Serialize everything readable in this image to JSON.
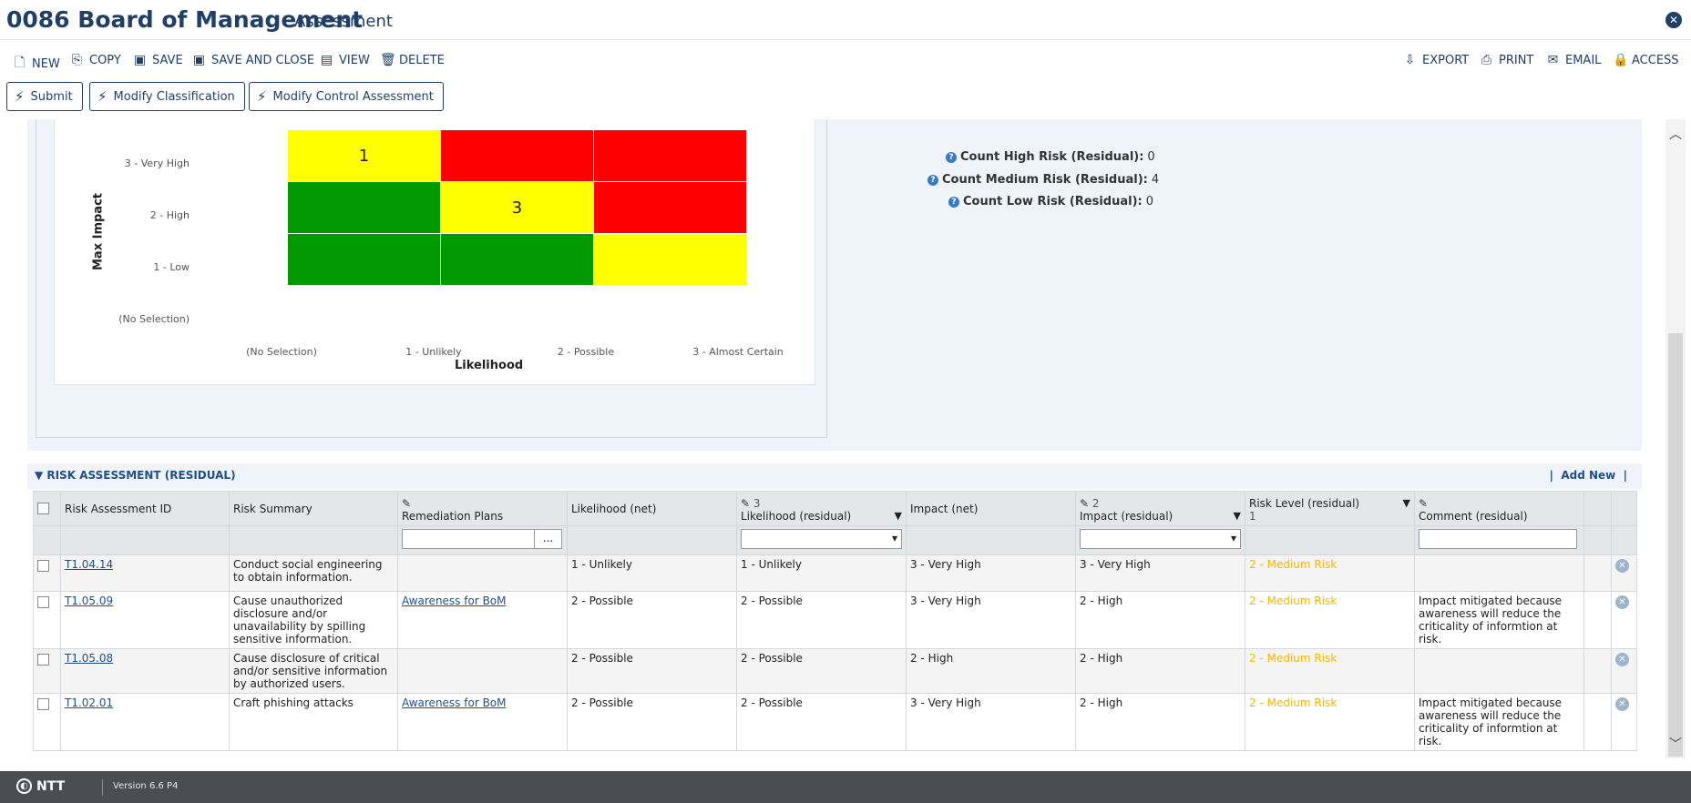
{
  "header": {
    "title": "0086 Board of Management",
    "subtitle": "Assessment",
    "close_icon": "close-icon"
  },
  "toolbar": {
    "left": [
      {
        "label": "NEW",
        "icon": "new-icon"
      },
      {
        "label": "COPY",
        "icon": "copy-icon"
      },
      {
        "label": "SAVE",
        "icon": "save-icon"
      },
      {
        "label": "SAVE AND CLOSE",
        "icon": "save-close-icon"
      },
      {
        "label": "VIEW",
        "icon": "view-icon"
      },
      {
        "label": "DELETE",
        "icon": "delete-icon"
      }
    ],
    "right": [
      {
        "label": "EXPORT",
        "icon": "export-icon"
      },
      {
        "label": "PRINT",
        "icon": "print-icon"
      },
      {
        "label": "EMAIL",
        "icon": "email-icon"
      },
      {
        "label": "ACCESS",
        "icon": "lock-icon"
      }
    ]
  },
  "actions": [
    "Submit",
    "Modify Classification",
    "Modify Control Assessment"
  ],
  "matrix": {
    "y_title": "Max Impact",
    "x_title": "Likelihood",
    "y_labels": [
      "3 - Very High",
      "2 - High",
      "1 - Low",
      "(No Selection)"
    ],
    "x_labels": [
      "(No Selection)",
      "1 - Unlikely",
      "2 - Possible",
      "3 - Almost Certain"
    ],
    "cells": [
      [
        "1",
        "",
        ""
      ],
      [
        "",
        "3",
        ""
      ],
      [
        "",
        "",
        ""
      ]
    ],
    "cell_colors": [
      [
        "#ffff00",
        "#ff0000",
        "#ff0000"
      ],
      [
        "#009900",
        "#ffff00",
        "#ff0000"
      ],
      [
        "#009900",
        "#009900",
        "#ffff00"
      ]
    ]
  },
  "stats": [
    {
      "label": "Count High Risk (Residual):",
      "value": "0"
    },
    {
      "label": "Count Medium Risk (Residual):",
      "value": "4"
    },
    {
      "label": "Count Low Risk (Residual):",
      "value": "0"
    }
  ],
  "section": {
    "title": "RISK ASSESSMENT (RESIDUAL)",
    "add_new": "Add New"
  },
  "columns": {
    "id": "Risk Assessment ID",
    "summary": "Risk Summary",
    "remediation": "Remediation Plans",
    "likelihood_net": "Likelihood (net)",
    "likelihood_res": "Likelihood (residual)",
    "likelihood_res_count": "3",
    "impact_net": "Impact (net)",
    "impact_res": "Impact (residual)",
    "impact_res_count": "2",
    "risk_level": "Risk Level (residual)",
    "risk_level_count": "1",
    "comment": "Comment (residual)",
    "filter_dots": "..."
  },
  "rows": [
    {
      "id": "T1.04.14",
      "summary": "Conduct social engineering to obtain information.",
      "remediation": "",
      "likelihood_net": "1 - Unlikely",
      "likelihood_res": "1 - Unlikely",
      "impact_net": "3 - Very High",
      "impact_res": "3 - Very High",
      "risk_level": "2 - Medium Risk",
      "comment": ""
    },
    {
      "id": "T1.05.09",
      "summary": "Cause unauthorized disclosure and/or unavailability by spilling sensitive information.",
      "remediation": "Awareness for BoM",
      "likelihood_net": "2 - Possible",
      "likelihood_res": "2 - Possible",
      "impact_net": "3 - Very High",
      "impact_res": "2 - High",
      "risk_level": "2 - Medium Risk",
      "comment": "Impact mitigated because awareness will reduce the criticality of informtion at risk."
    },
    {
      "id": "T1.05.08",
      "summary": "Cause disclosure of critical and/or sensitive information by authorized users.",
      "remediation": "",
      "likelihood_net": "2 - Possible",
      "likelihood_res": "2 - Possible",
      "impact_net": "2 - High",
      "impact_res": "2 - High",
      "risk_level": "2 - Medium Risk",
      "comment": ""
    },
    {
      "id": "T1.02.01",
      "summary": "Craft phishing attacks",
      "remediation": "Awareness for BoM",
      "likelihood_net": "2 - Possible",
      "likelihood_res": "2 - Possible",
      "impact_net": "3 - Very High",
      "impact_res": "2 - High",
      "risk_level": "2 - Medium Risk",
      "comment": "Impact mitigated because awareness will reduce the criticality of informtion at risk."
    }
  ],
  "footer": {
    "brand": "NTT",
    "version": "Version 6.6 P4"
  }
}
